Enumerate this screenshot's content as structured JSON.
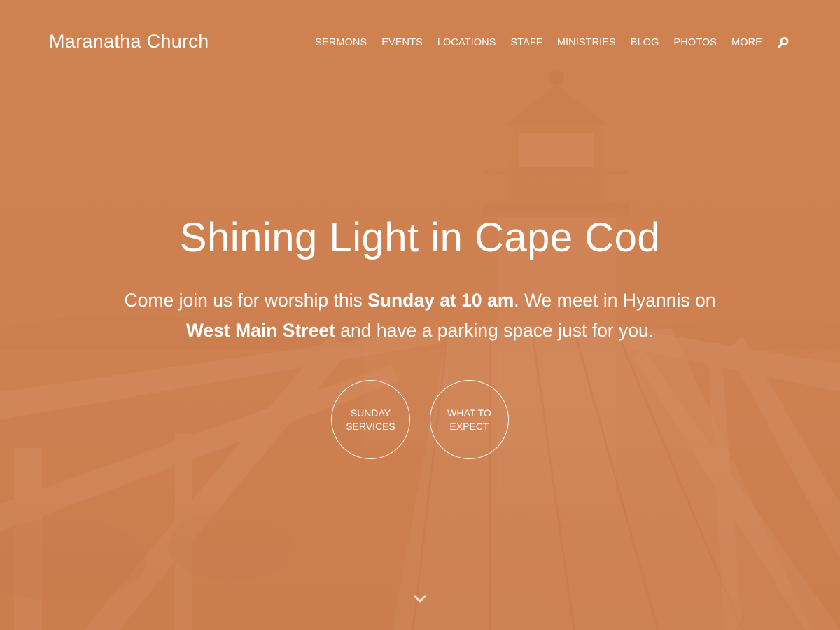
{
  "site": {
    "title": "Maranatha Church"
  },
  "nav": {
    "items": [
      {
        "label": "SERMONS"
      },
      {
        "label": "EVENTS"
      },
      {
        "label": "LOCATIONS"
      },
      {
        "label": "STAFF"
      },
      {
        "label": "MINISTRIES"
      },
      {
        "label": "BLOG"
      },
      {
        "label": "PHOTOS"
      },
      {
        "label": "MORE"
      }
    ],
    "search_icon": "search-icon"
  },
  "hero": {
    "title": "Shining Light in Cape Cod",
    "text": {
      "part1": "Come join us for worship this ",
      "bold1": "Sunday at 10 am",
      "part2": ". We meet in Hyannis on ",
      "bold2": "West Main Street",
      "part3": " and have a parking space just for you."
    },
    "buttons": [
      {
        "line1": "SUNDAY",
        "line2": "SERVICES"
      },
      {
        "line1": "WHAT TO",
        "line2": "EXPECT"
      }
    ],
    "scroll_icon": "chevron-down-icon"
  },
  "colors": {
    "overlay": "#cf7f4e",
    "text": "#ffffff"
  }
}
